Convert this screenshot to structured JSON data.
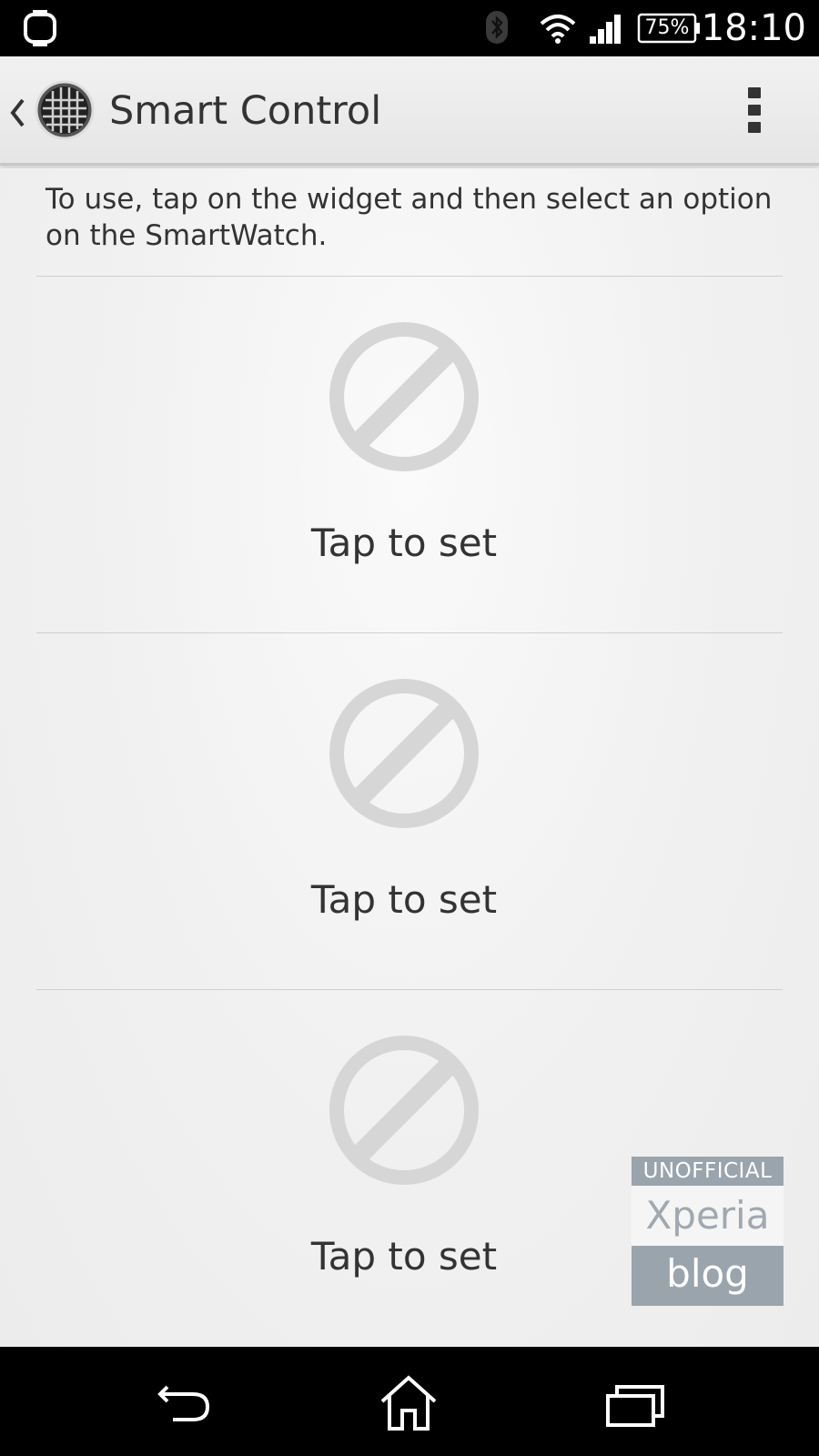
{
  "status_bar": {
    "battery_text": "75%",
    "time": "18:10",
    "icons": [
      "smartwatch-icon",
      "bluetooth-icon",
      "wifi-icon",
      "signal-icon",
      "battery-icon"
    ]
  },
  "action_bar": {
    "title": "Smart Control",
    "icons": [
      "back-chevron-icon",
      "app-grid-icon",
      "overflow-menu-icon"
    ]
  },
  "content": {
    "intro": "To use, tap on the widget and then select an option on the SmartWatch.",
    "slots": [
      {
        "label": "Tap to set",
        "icon": "not-set-icon"
      },
      {
        "label": "Tap to set",
        "icon": "not-set-icon"
      },
      {
        "label": "Tap to set",
        "icon": "not-set-icon"
      }
    ]
  },
  "watermark": {
    "line1": "UNOFFICIAL",
    "line2": "Xperia",
    "line3": "blog"
  },
  "nav_bar": {
    "icons": [
      "back-icon",
      "home-icon",
      "recents-icon"
    ]
  },
  "colors": {
    "status_bar_bg": "#000000",
    "action_bar_bg": "#ebebeb",
    "content_bg": "#f1f1f1",
    "text": "#333333",
    "icon_gray": "#d6d6d6",
    "watermark_gray": "#9aa4ad"
  }
}
